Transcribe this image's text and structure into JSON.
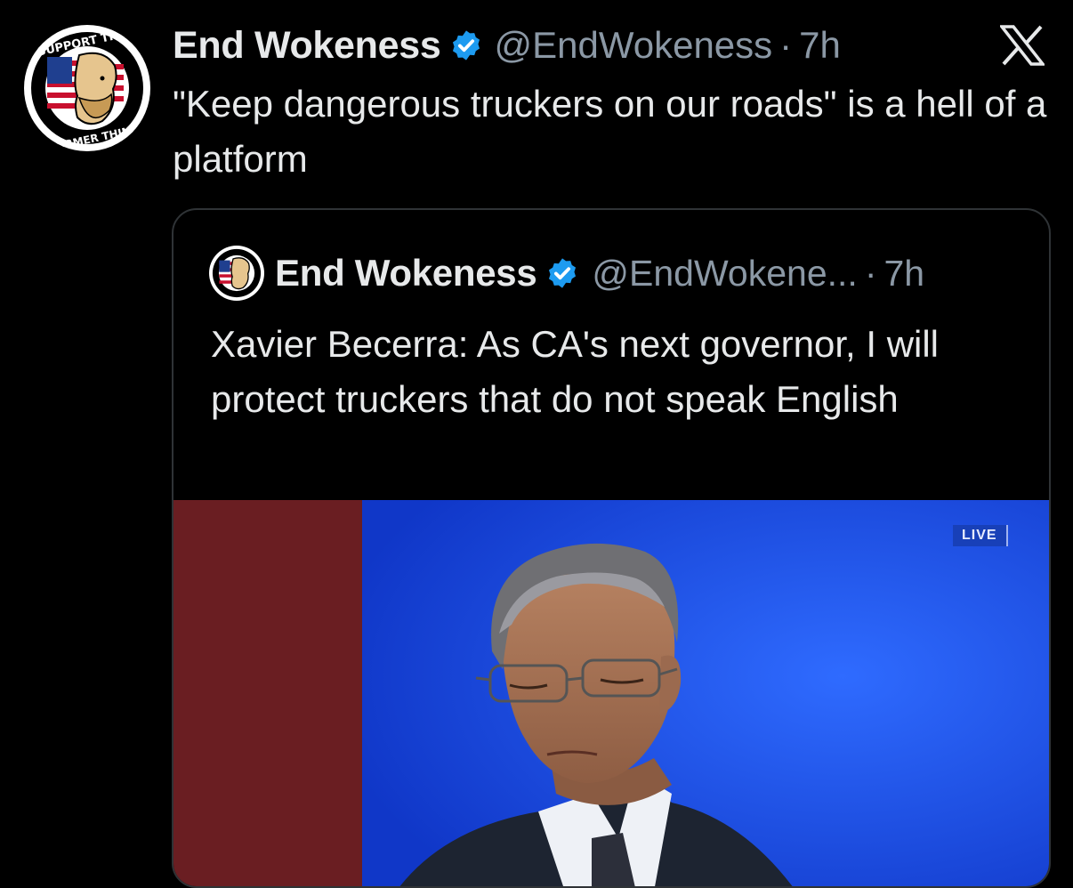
{
  "tweet": {
    "author_name": "End Wokeness",
    "author_handle": "@EndWokeness",
    "separator": "·",
    "time": "7h",
    "text": "\"Keep dangerous truckers on our roads\" is a hell of a platform",
    "avatar_icon": "i-support-the-former-things-logo",
    "verified_icon": "verified-badge-icon",
    "platform_icon": "x-logo-icon"
  },
  "quoted_tweet": {
    "author_name": "End Wokeness",
    "author_handle": "@EndWokene...",
    "separator": "·",
    "time": "7h",
    "text": "Xavier Becerra: As CA's next governor, I will protect truckers that do not speak English",
    "media": {
      "live_label": "LIVE"
    }
  },
  "colors": {
    "background": "#000000",
    "text_primary": "#e7e9ea",
    "text_secondary": "#8b98a5",
    "verified_blue": "#1d9bf0",
    "border": "#2f3336"
  }
}
